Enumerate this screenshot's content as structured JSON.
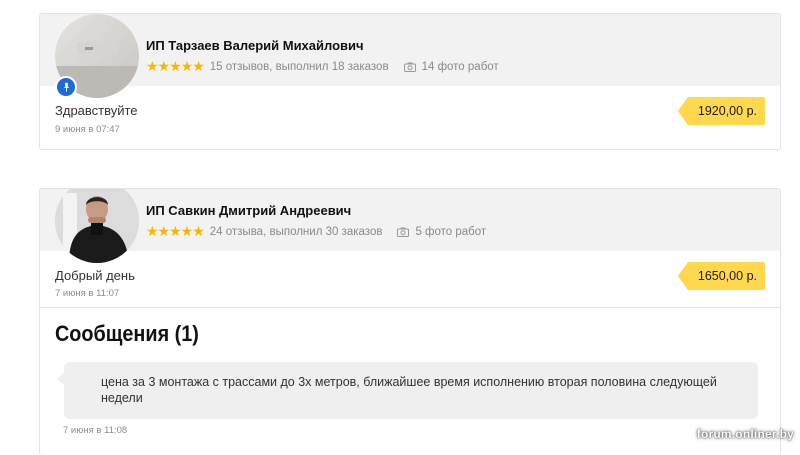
{
  "offers": [
    {
      "name": "ИП Тарзаев Валерий Михайлович",
      "stars": "★★★★★",
      "reviews": "15 отзывов, выполнил 18 заказов",
      "photos": "14 фото работ",
      "greeting": "Здравствуйте",
      "date": "9 июня в 07:47",
      "price": "1920,00 р.",
      "pinned": true
    },
    {
      "name": "ИП Савкин Дмитрий Андреевич",
      "stars": "★★★★★",
      "reviews": "24 отзыва, выполнил 30 заказов",
      "photos": "5 фото работ",
      "greeting": "Добрый день",
      "date": "7 июня в 11:07",
      "price": "1650,00 р."
    }
  ],
  "messages": {
    "title": "Сообщения (1)",
    "items": [
      {
        "text": "цена за 3 монтажа с трассами до 3х метров, ближайшее время исполнению вторая половина следующей недели",
        "date": "7 июня в 11:08"
      }
    ]
  },
  "watermark": "forum.onliner.by",
  "colors": {
    "star": "#f5b800",
    "price_tag": "#ffd84d",
    "pin_badge": "#1e6ad6",
    "header_bg": "#f2f2f2"
  }
}
